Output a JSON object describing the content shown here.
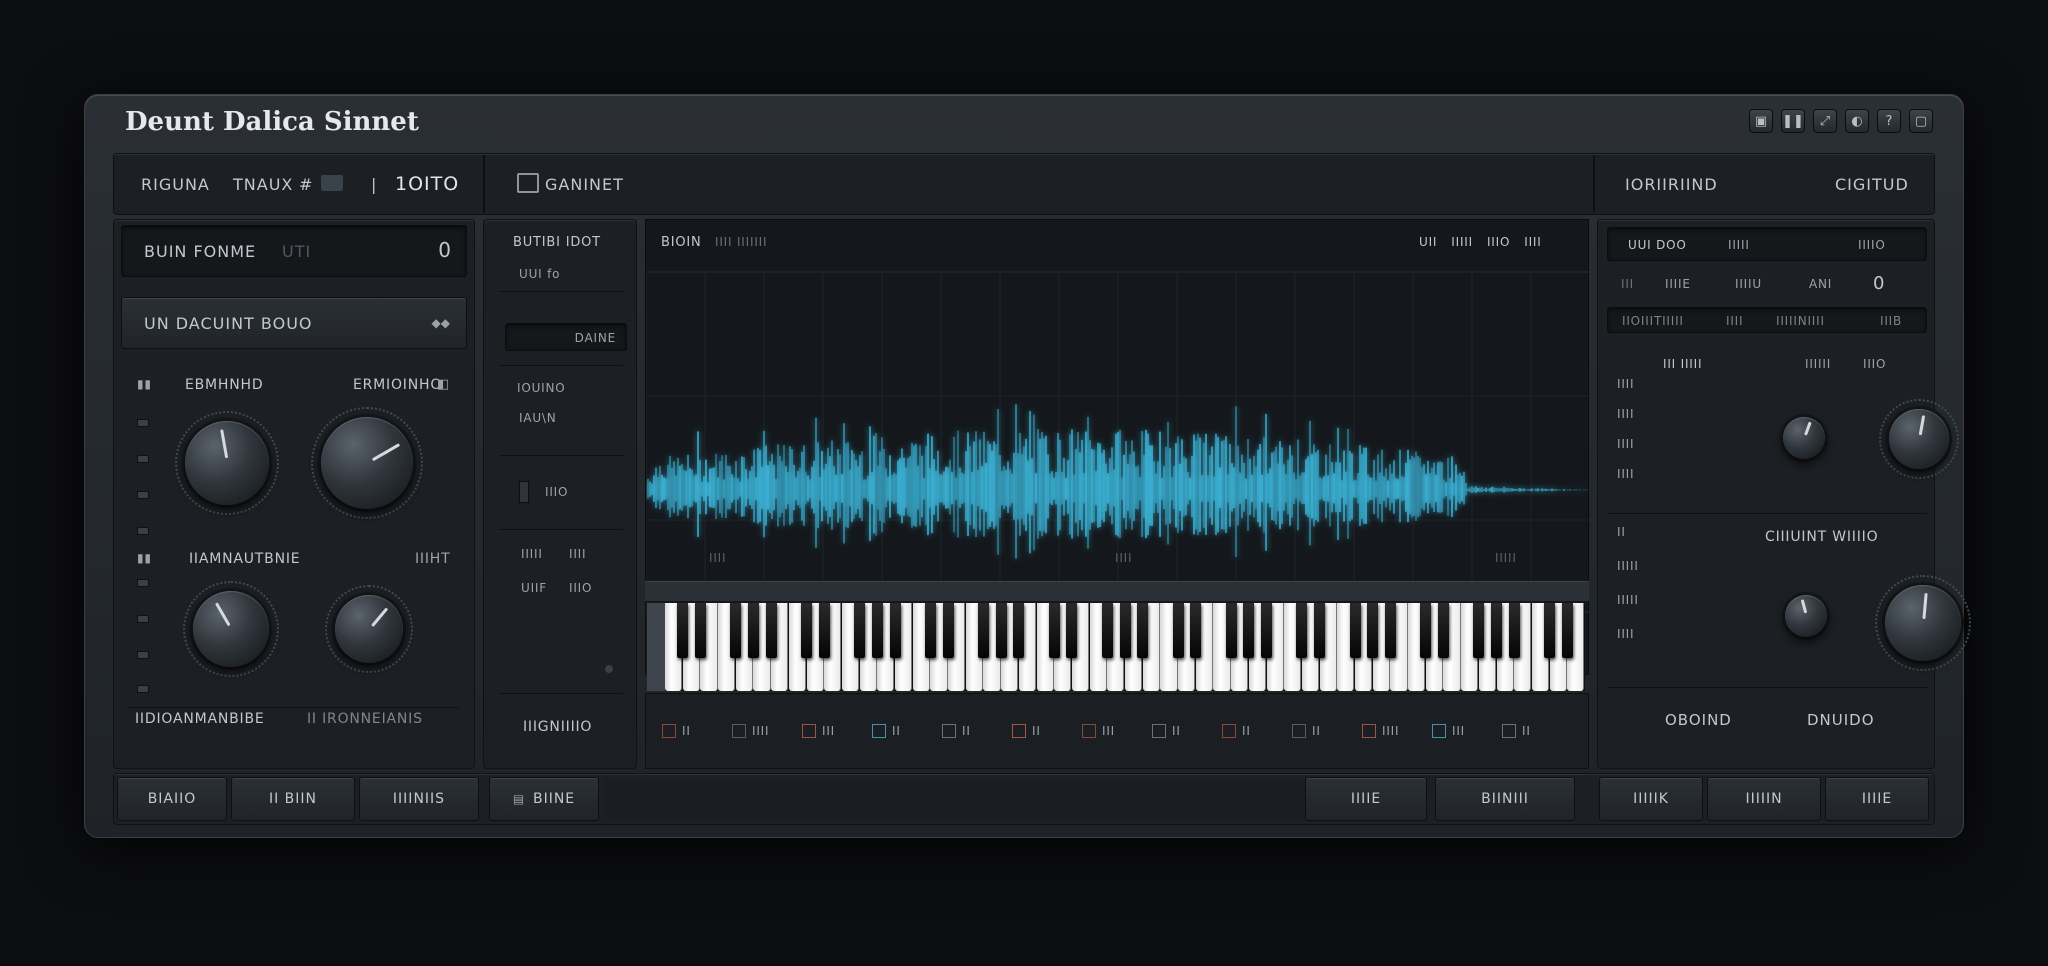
{
  "app": {
    "title": "Deunt Dalica Sinnet"
  },
  "window_controls": [
    {
      "glyph": "▣",
      "icon": "save-icon"
    },
    {
      "glyph": "❚❚",
      "icon": "pause-icon"
    },
    {
      "glyph": "⤢",
      "icon": "expand-icon"
    },
    {
      "glyph": "◐",
      "icon": "theme-icon"
    },
    {
      "glyph": "?",
      "icon": "help-icon"
    },
    {
      "glyph": "▢",
      "icon": "close-icon"
    }
  ],
  "header": {
    "left_label": "RIGUNA",
    "left_mode": "TNAUX",
    "left_sharp": "#",
    "left_sep": "|",
    "left_value": "1OITO",
    "center_label": "GANINET",
    "right_label": "IORIIRIIND",
    "right_value": "CIGITUD"
  },
  "left_panel": {
    "preset_field": "BUIN FONME",
    "preset_suffix": "UTI",
    "preset_glyph": "0",
    "source_field": "UN DACUINT BOUO",
    "section1_title": "EBMHNHD",
    "section1_right": "ERMIOINHO",
    "section1_right_icon": "◧",
    "section2_title": "IIAMNAUTBNIE",
    "section2_right": "IIIHT",
    "footer_label": "IIDIOANMANBIBE",
    "footer_label2": "II IRONNEIANIS"
  },
  "mid_column": {
    "header": "BUTIBI IDOT",
    "sub": "UUI fo",
    "display": "DAINE",
    "item1": "IOUINO",
    "item2": "IAU\\N",
    "toggle": "IIIO",
    "grid": [
      "IIIII",
      "IIII",
      "UIIF",
      "IIIO"
    ],
    "footer": "IIIGNIIIIO"
  },
  "waveform": {
    "title": "BIOIN",
    "subtitle": "IIII IIIIIII",
    "controls": [
      "UII",
      "IIIII",
      "IIIO",
      "IIII"
    ],
    "markers": [
      "IIII",
      "IIII",
      "IIIII"
    ],
    "color": "#3fc3ea"
  },
  "keyboard": {
    "bottom_tools": [
      "II",
      "IIII",
      "III",
      "II",
      "II",
      "II",
      "III",
      "II",
      "II",
      "II",
      "IIII",
      "III",
      "II"
    ]
  },
  "right_panel": {
    "row1": [
      "UUI DOO",
      "IIIII",
      "IIIIO"
    ],
    "row2": [
      "III",
      "IIIIE",
      "IIIIU",
      "ANI",
      "0"
    ],
    "row3": [
      "IIOIIITIIIII",
      "IIII",
      "IIIIINIIII",
      "IIIB"
    ],
    "row4": [
      "III IIIII",
      "IIIIII",
      "IIIO"
    ],
    "side_labels_a": [
      "IIII",
      "IIII",
      "IIII",
      "IIII"
    ],
    "section2_title": "CIIIUINT WIIIIO",
    "side_labels_b": [
      "II",
      "IIIII",
      "IIIII",
      "IIII"
    ],
    "footer_left": "OBOIND",
    "footer_right": "DNUIDO"
  },
  "bottom_bar": {
    "left_buttons": [
      "BIAIIO",
      "II BIIN",
      "IIIINIIS"
    ],
    "center_button": "BIINE",
    "center_icon": "▤",
    "mid_buttons": [
      "IIIIE",
      "BIINIII"
    ],
    "right_buttons": [
      "IIIIIK",
      "IIIIIN",
      "IIIIE"
    ]
  }
}
